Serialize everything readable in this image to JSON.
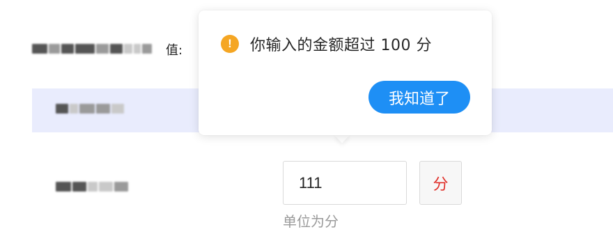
{
  "form": {
    "row1": {
      "label_suffix": "值:"
    },
    "amount": {
      "value": "111",
      "unit_label": "分",
      "hint": "单位为分"
    }
  },
  "popover": {
    "icon": "warning-icon",
    "message": "你输入的金额超过 100 分",
    "confirm_label": "我知道了",
    "colors": {
      "icon": "#f5a623",
      "button": "#1e8ff5"
    }
  },
  "colors": {
    "highlight_band": "#e9ecfd",
    "unit_text": "#e0302a",
    "hint_text": "#9a9a9a"
  }
}
